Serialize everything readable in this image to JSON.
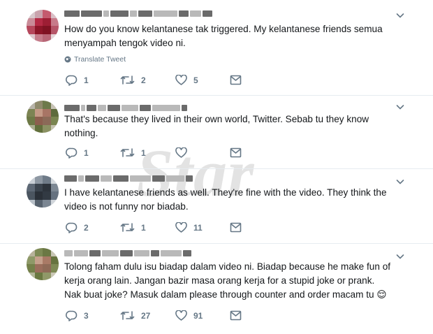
{
  "watermark": "Star",
  "tweets": [
    {
      "text": "How do you know kelantanese tak triggered. My kelantanese friends semua menyampah tengok video ni.",
      "translate_label": "Translate Tweet",
      "reply_count": "1",
      "retweet_count": "2",
      "like_count": "5"
    },
    {
      "text": "That's because they lived in their own world, Twitter. Sebab tu they know nothing.",
      "reply_count": "1",
      "retweet_count": "1",
      "like_count": ""
    },
    {
      "text": "I have kelantanese friends as well. They're fine with the video. They think the video is not funny nor biadab.",
      "reply_count": "2",
      "retweet_count": "1",
      "like_count": "11"
    },
    {
      "text": "Tolong faham dulu isu biadap dalam video ni. Biadap because he make fun of kerja orang lain. Jangan bazir masa orang kerja for a stupid joke or prank. Nak buat joke? Masuk dalam please through counter and order macam tu 😌",
      "reply_count": "3",
      "retweet_count": "27",
      "like_count": "91"
    }
  ],
  "icons": {
    "reply": "reply-icon",
    "retweet": "retweet-icon",
    "like": "heart-icon",
    "message": "direct-message-icon",
    "more": "chevron-down-icon",
    "globe": "globe-icon"
  },
  "colors": {
    "text": "#14171a",
    "muted": "#657786",
    "divider": "#e6ecf0"
  }
}
